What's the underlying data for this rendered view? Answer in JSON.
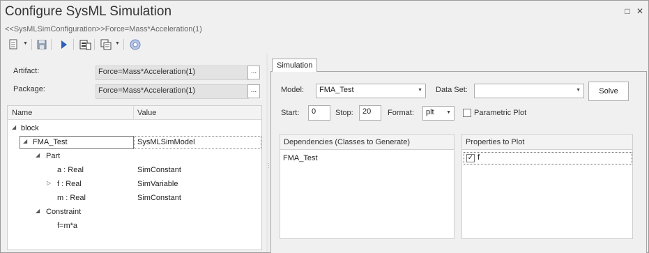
{
  "window": {
    "title": "Configure SysML Simulation",
    "subtitle": "<<SysMLSimConfiguration>>Force=Mass*Acceleration(1)",
    "restore_glyph": "□",
    "close_glyph": "✕"
  },
  "toolbar": {
    "buttons": [
      "new-document-icon",
      "save-icon",
      "run-icon",
      "generate-icon",
      "copy-icon",
      "help-icon"
    ]
  },
  "artifact": {
    "label": "Artifact:",
    "value": "Force=Mass*Acceleration(1)",
    "browse": "..."
  },
  "package": {
    "label": "Package:",
    "value": "Force=Mass*Acceleration(1)",
    "browse": "..."
  },
  "tree": {
    "col_name": "Name",
    "col_value": "Value",
    "rows": [
      {
        "name": "block",
        "value": "",
        "expander": "◢"
      },
      {
        "name": "FMA_Test",
        "value": "SysMLSimModel",
        "expander": "◢"
      },
      {
        "name": "Part",
        "value": "",
        "expander": "◢"
      },
      {
        "name": "a : Real",
        "value": "SimConstant",
        "expander": ""
      },
      {
        "name": "f : Real",
        "value": "SimVariable",
        "expander": "▷"
      },
      {
        "name": "m : Real",
        "value": "SimConstant",
        "expander": ""
      },
      {
        "name": "Constraint",
        "value": "",
        "expander": "◢"
      },
      {
        "name": "f=m*a",
        "value": "",
        "expander": ""
      }
    ]
  },
  "simulation": {
    "tab_label": "Simulation",
    "model_label": "Model:",
    "model_value": "FMA_Test",
    "dataset_label": "Data Set:",
    "dataset_value": "",
    "solve_label": "Solve",
    "start_label": "Start:",
    "start_value": "0",
    "stop_label": "Stop:",
    "stop_value": "20",
    "format_label": "Format:",
    "format_value": "plt",
    "parametric_label": "Parametric Plot",
    "parametric_checked": false,
    "dependencies_header": "Dependencies (Classes to Generate)",
    "dependencies": [
      "FMA_Test"
    ],
    "properties_header": "Properties to Plot",
    "properties": [
      {
        "name": "f",
        "checked": true,
        "check_glyph": "✓"
      }
    ]
  }
}
